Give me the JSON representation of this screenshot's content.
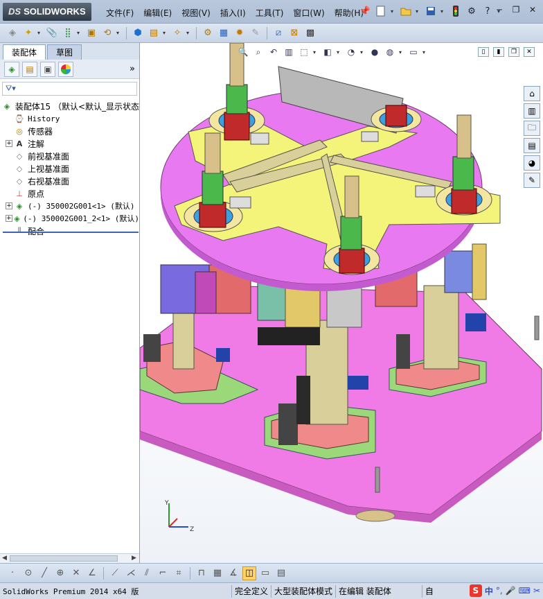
{
  "app": {
    "logo_prefix": "DS",
    "logo_text": "SOLIDWORKS"
  },
  "menu": [
    {
      "label": "文件(F)"
    },
    {
      "label": "编辑(E)"
    },
    {
      "label": "视图(V)"
    },
    {
      "label": "插入(I)"
    },
    {
      "label": "工具(T)"
    },
    {
      "label": "窗口(W)"
    },
    {
      "label": "帮助(H)"
    }
  ],
  "tabs": {
    "assembly": "装配体",
    "sketch": "草图"
  },
  "manager": {
    "more": "»"
  },
  "tree": {
    "root": "装配体15  （默认<默认_显示状态",
    "items": [
      {
        "label": "History",
        "mono": true,
        "expandable": false,
        "icon": "history-icon"
      },
      {
        "label": "传感器",
        "expandable": false,
        "icon": "sensor-icon"
      },
      {
        "label": "注解",
        "expandable": true,
        "icon": "annotation-icon"
      },
      {
        "label": "前视基准面",
        "expandable": false,
        "icon": "plane-icon"
      },
      {
        "label": "上视基准面",
        "expandable": false,
        "icon": "plane-icon"
      },
      {
        "label": "右视基准面",
        "expandable": false,
        "icon": "plane-icon"
      },
      {
        "label": "原点",
        "expandable": false,
        "icon": "origin-icon"
      },
      {
        "label": "(-) 350002G001<1> (默认)",
        "expandable": true,
        "icon": "part-icon"
      },
      {
        "label": "(-) 350002G001_2<1> (默认)",
        "expandable": true,
        "icon": "part-icon"
      },
      {
        "label": "配合",
        "expandable": false,
        "icon": "mates-icon"
      }
    ]
  },
  "triad": {
    "x": "Z",
    "y": "Y"
  },
  "status": {
    "app_name": "SolidWorks Premium 2014 x64 版",
    "defined": "完全定义",
    "mode": "大型装配体模式",
    "editing": "在编辑 装配体",
    "custom": "自"
  },
  "ime": {
    "label": "S",
    "lang": "中"
  },
  "colors": {
    "turntable": "#e879f0",
    "plate": "#f4f47a",
    "base": "#f07ae6",
    "accent": "#3a64b6"
  }
}
